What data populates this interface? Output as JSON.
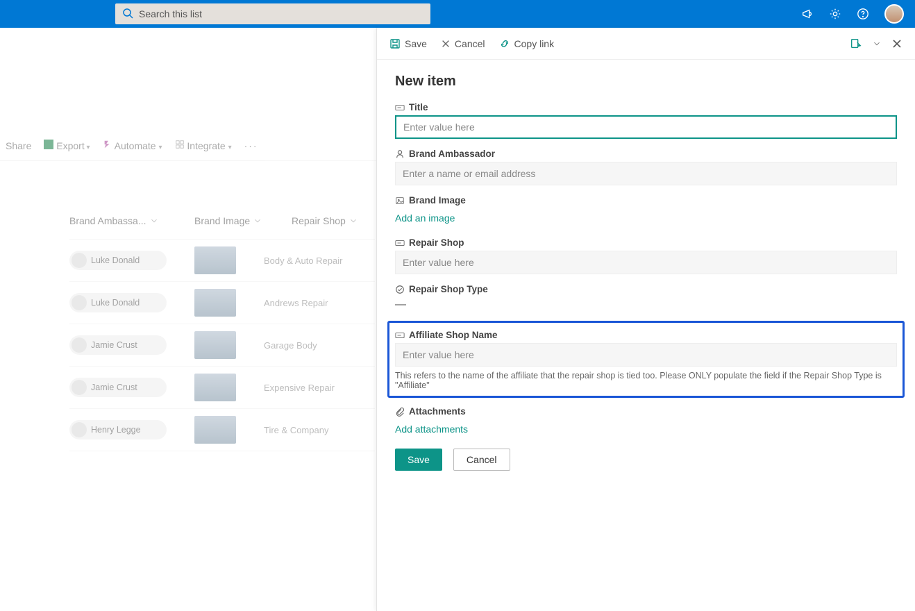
{
  "search": {
    "placeholder": "Search this list"
  },
  "cmdbar": {
    "share": "Share",
    "export": "Export",
    "automate": "Automate",
    "integrate": "Integrate"
  },
  "list": {
    "headers": {
      "ambassador": "Brand Ambassa...",
      "image": "Brand Image",
      "shop": "Repair Shop"
    },
    "rows": [
      {
        "name": "Luke Donald",
        "shop": "Body & Auto Repair"
      },
      {
        "name": "Luke Donald",
        "shop": "Andrews Repair"
      },
      {
        "name": "Jamie Crust",
        "shop": "Garage Body"
      },
      {
        "name": "Jamie Crust",
        "shop": "Expensive Repair"
      },
      {
        "name": "Henry Legge",
        "shop": "Tire & Company"
      }
    ]
  },
  "panel": {
    "cmd": {
      "save": "Save",
      "cancel": "Cancel",
      "copy": "Copy link"
    },
    "title": "New item",
    "fields": {
      "title": {
        "label": "Title",
        "placeholder": "Enter value here"
      },
      "ambassador": {
        "label": "Brand Ambassador",
        "placeholder": "Enter a name or email address"
      },
      "image": {
        "label": "Brand Image",
        "action": "Add an image"
      },
      "repairshop": {
        "label": "Repair Shop",
        "placeholder": "Enter value here"
      },
      "shoptype": {
        "label": "Repair Shop Type",
        "value": "—"
      },
      "affiliate": {
        "label": "Affiliate Shop Name",
        "placeholder": "Enter value here",
        "help": "This refers to the name of the affiliate that the repair shop is tied too. Please ONLY populate the field if the Repair Shop Type is \"Affiliate\""
      },
      "attachments": {
        "label": "Attachments",
        "action": "Add attachments"
      }
    },
    "buttons": {
      "save": "Save",
      "cancel": "Cancel"
    }
  }
}
